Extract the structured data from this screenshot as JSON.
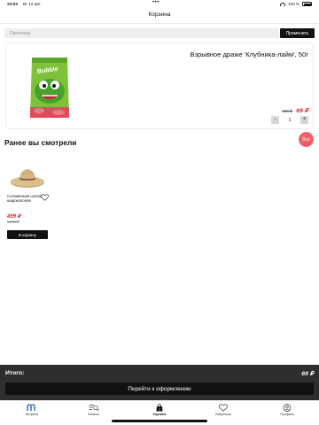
{
  "status_bar": {
    "time": "23:53",
    "date": "Вт 12 авг.",
    "dots": "•••",
    "battery": "100 %"
  },
  "header": {
    "title": "Корзина"
  },
  "promo": {
    "placeholder": "Промокод",
    "button_label": "Применить"
  },
  "cart_item": {
    "title": "Взрывное драже 'Клубника-лайм', 50г",
    "old_price": "129 ₽",
    "price": "69 ₽",
    "quantity": "1",
    "decrement_label": "-",
    "increment_label": "+"
  },
  "recently_viewed": {
    "title": "Ранее вы смотрели",
    "all_label": "Все",
    "items": [
      {
        "name": "Соломенная шляпа широкополая",
        "price": "499 ₽",
        "old_price": "1 299 ₽",
        "button_label": "В корзину"
      }
    ]
  },
  "checkout": {
    "total_label": "Итого:",
    "total_value": "69 ₽",
    "button_label": "Перейти к оформлению"
  },
  "tab_bar": {
    "tabs": [
      {
        "label": "Витрина",
        "icon": "logo-m-icon"
      },
      {
        "label": "Каталог",
        "icon": "catalog-search-icon"
      },
      {
        "label": "Корзина",
        "icon": "bag-icon",
        "badge": "1",
        "active": true
      },
      {
        "label": "Избранное",
        "icon": "heart-icon"
      },
      {
        "label": "Профиль",
        "icon": "user-icon"
      }
    ]
  },
  "colors": {
    "accent_red": "#e2222a",
    "badge_pink": "#f0606a",
    "checkout_panel": "#2e2e2e",
    "button_dark": "#111111"
  }
}
